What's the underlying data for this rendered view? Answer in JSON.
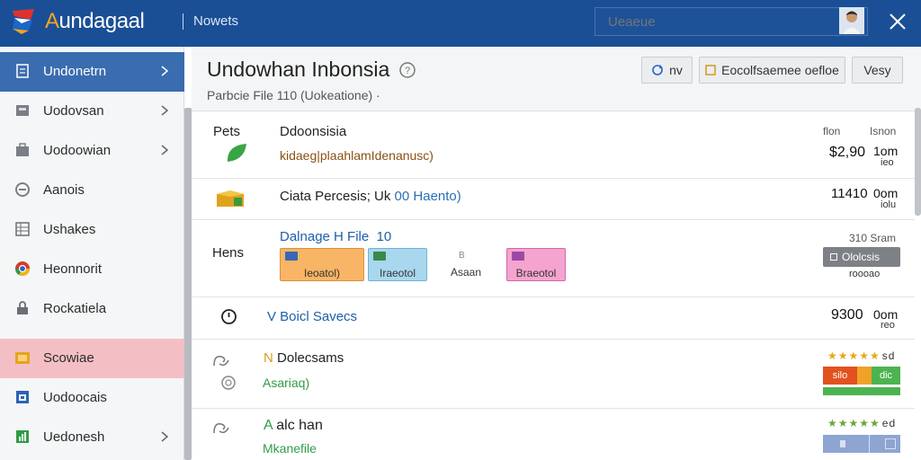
{
  "app": {
    "title_first": "A",
    "title_rest": "undagaal",
    "tab": "Nowets",
    "search_placeholder": "Ueaeue"
  },
  "sidebar": {
    "items": [
      {
        "label": "Undonetrn",
        "icon": "document-icon"
      },
      {
        "label": "Uodovsan",
        "icon": "archive-icon"
      },
      {
        "label": "Uodoowian",
        "icon": "bag-icon"
      },
      {
        "label": "Aanois",
        "icon": "circle-icon"
      },
      {
        "label": "Ushakes",
        "icon": "grid-icon"
      },
      {
        "label": "Heonnorit",
        "icon": "chrome-icon"
      },
      {
        "label": "Rockatiela",
        "icon": "lock-icon"
      },
      {
        "label": "Scowiae",
        "icon": "folder-icon"
      },
      {
        "label": "Uodoocais",
        "icon": "calendar-icon"
      },
      {
        "label": "Uedonesh",
        "icon": "chart-icon"
      }
    ]
  },
  "header": {
    "title": "Undowhan Inbonsia",
    "subtitle": "Parbcie File 110 (Uokeatione) ·",
    "btn1": "nv",
    "btn2": "Eocolfsaemee oefloe",
    "btn3": "Vesy"
  },
  "rows": {
    "r1": {
      "left": "Pets",
      "title": "Ddoonsisia",
      "sub": "kidaeg|plaahlamIdenanusc)",
      "col1": "flon",
      "col2": "Isnon",
      "value": "$2,90",
      "unit": "1om",
      "sub2": "ieo"
    },
    "r2": {
      "title_a": "Ciata Percesis; Uk",
      "title_b": "00 Haento)",
      "value": "11410",
      "unit": "0om",
      "sub2": "iolu"
    },
    "r3": {
      "left": "Hens",
      "title": "Dalnage H File",
      "count": "10",
      "tag1": "Ieoatol)",
      "tag2": "Iraeotol",
      "tag3": "Asaan",
      "tag4": "Braeotol",
      "mini3": "B",
      "right_top": "310 Sram",
      "badge": "Ololcsis",
      "right_sub": "roooao"
    },
    "r4": {
      "title": "V Boicl Savecs",
      "value": "9300",
      "unit": "0om",
      "sub2": "reo"
    },
    "r5": {
      "title_letter": "N",
      "title": "Dolecsams",
      "sub": "Asariaq)",
      "stars": "★★★★★",
      "stars_text": "sd",
      "bar1": "silo",
      "bar2": "dic"
    },
    "r6": {
      "title_letter": "A",
      "title": "alc han",
      "sub": "Mkanefile",
      "stars": "★★★★★",
      "stars_text": "ed"
    }
  }
}
